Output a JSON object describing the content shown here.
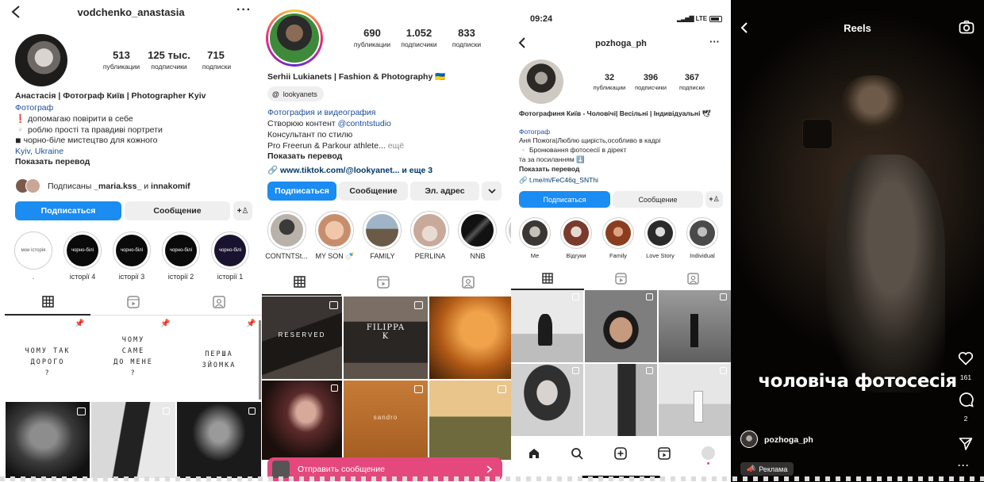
{
  "p1": {
    "username": "vodchenko_anastasia",
    "stats": [
      {
        "num": "513",
        "label": "публикации"
      },
      {
        "num": "125 тыс.",
        "label": "подписчики"
      },
      {
        "num": "715",
        "label": "подписки"
      }
    ],
    "bio_name": "Анастасія | Фотограф Київ | Photographer Kyiv",
    "bio_category": "Фотограф",
    "bio_lines": [
      "❗ допомагаю повірити в себе",
      "▫️ роблю прості та правдиві портрети",
      "◾ чорно-біле мистецтво для кожного"
    ],
    "location": "Kyiv, Ukraine",
    "translate": "Показать перевод",
    "followed_prefix": "Подписаны ",
    "followed_user1": "_maria.kss_",
    "followed_and": " и ",
    "followed_user2": "innakomif",
    "follow_btn": "Подписаться",
    "message_btn": "Сообщение",
    "highlights": [
      {
        "cover": "мои історія",
        "label": "."
      },
      {
        "cover": "чорно-білі",
        "label": "історії 4"
      },
      {
        "cover": "чорно-білі",
        "label": "історії 3"
      },
      {
        "cover": "чорно-білі",
        "label": "історії 2"
      },
      {
        "cover": "чорно-білі",
        "label": "історії 1"
      }
    ],
    "text_posts": [
      [
        "ЧОМУ ТАК",
        "ДОРОГО",
        "?"
      ],
      [
        "ЧОМУ",
        "САМЕ",
        "ДО МЕНЕ",
        "?"
      ],
      [
        "ПЕРША",
        "ЗЙОМКА"
      ]
    ]
  },
  "p2": {
    "stats": [
      {
        "num": "690",
        "label": "публикации"
      },
      {
        "num": "1.052",
        "label": "подписчики"
      },
      {
        "num": "833",
        "label": "подписки"
      }
    ],
    "bio_name": "Serhii Lukianets | Fashion & Photography 🇺🇦",
    "threads": "lookyanets",
    "category": "Фотография и видеография",
    "line1_prefix": "Створюю контент ",
    "line1_mention": "@contntstudio",
    "line2": "Консультант по стилю",
    "line3": "Pro Freerun & Parkour athlete...",
    "more": "ещё",
    "translate": "Показать перевод",
    "link": "www.tiktok.com/@lookyanet...",
    "link_more": "и еще 3",
    "follow_btn": "Подписаться",
    "message_btn": "Сообщение",
    "email_btn": "Эл. адрес",
    "highlights": [
      "CONTNTSt...",
      "MY SON 🍼",
      "FAMILY",
      "PERLINA",
      "NNB"
    ],
    "grid_texts": [
      "RESERVED",
      "FILIPPA K",
      "sandro"
    ],
    "dm_bar": "Отправить сообщение"
  },
  "p3": {
    "time": "09:24",
    "network": "LTE",
    "username": "pozhoga_ph",
    "stats": [
      {
        "num": "32",
        "label": "публикации"
      },
      {
        "num": "396",
        "label": "подписчики"
      },
      {
        "num": "367",
        "label": "подписки"
      }
    ],
    "bio_name": "Фотографиня Київ - Чоловічі| Весільні | Індивідуальні 🕊",
    "category": "Фотограф",
    "bio_lines": [
      "Аня Пожога|Люблю щирість,особливо в кадрі",
      "▫️ Бронювання фотосесії в дірект",
      "та за посиланням ⬇️"
    ],
    "translate": "Показать перевод",
    "link": "t.me/m/FeC46q_SNThi",
    "follow_btn": "Подписаться",
    "message_btn": "Сообщение",
    "highlights": [
      "Me",
      "Відгуки",
      "Family",
      "Love Story",
      "Individual"
    ]
  },
  "p4": {
    "title": "Reels",
    "caption": "чоловіча фотосесія",
    "likes": "161",
    "comments": "2",
    "author": "pozhoga_ph",
    "ad": "Реклама"
  }
}
